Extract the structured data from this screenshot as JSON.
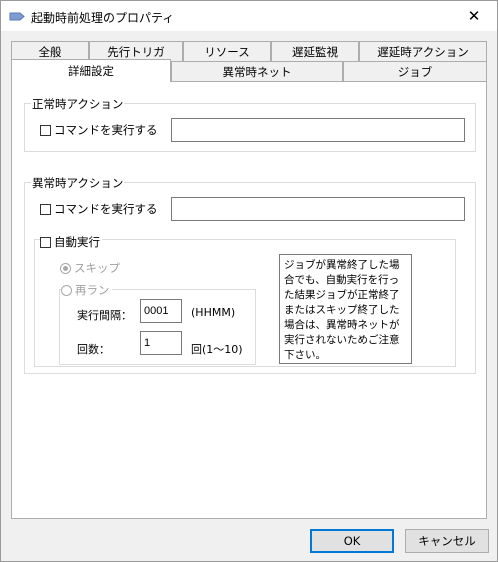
{
  "window": {
    "title": "起動時前処理のプロパティ",
    "close_glyph": "✕"
  },
  "tabs": {
    "row1": [
      "全般",
      "先行トリガ",
      "リソース",
      "遅延監視",
      "遅延時アクション"
    ],
    "row2": [
      "詳細設定",
      "異常時ネット",
      "ジョブ"
    ],
    "active": "詳細設定"
  },
  "normal_action": {
    "title": "正常時アクション",
    "run_command_label": "コマンドを実行する",
    "run_command_checked": false,
    "command_value": ""
  },
  "abnormal_action": {
    "title": "異常時アクション",
    "run_command_label": "コマンドを実行する",
    "run_command_checked": false,
    "command_value": "",
    "auto_run": {
      "label": "自動実行",
      "checked": false,
      "skip_label": "スキップ",
      "rerun_label": "再ラン",
      "selected": "スキップ",
      "interval_label": "実行間隔：",
      "interval_value": "0001",
      "interval_unit": "(HHMM)",
      "count_label": "回数：",
      "count_value": "1",
      "count_unit": "回(1～10)"
    },
    "note": "ジョブが異常終了した場合でも、自動実行を行った結果ジョブが正常終了またはスキップ終了した場合は、異常時ネットが実行されないためご注意下さい。"
  },
  "buttons": {
    "ok": "OK",
    "cancel": "キャンセル"
  }
}
